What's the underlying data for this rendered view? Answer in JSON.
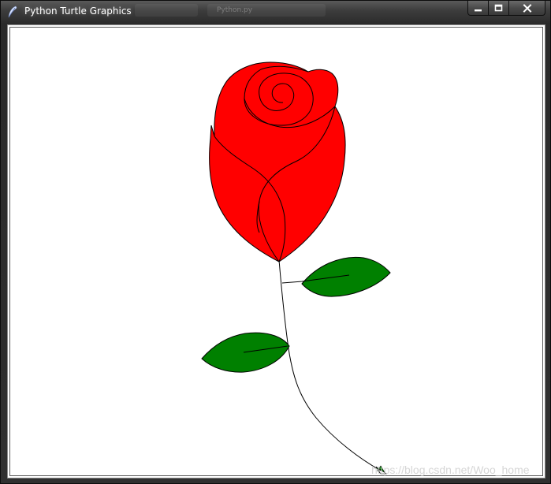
{
  "window": {
    "title": "Python Turtle Graphics",
    "background_tab": "Python.py",
    "controls": {
      "minimize": "minimize",
      "maximize": "maximize",
      "close": "close"
    }
  },
  "canvas": {
    "background": "#ffffff",
    "drawing": "rose",
    "colors": {
      "petal_fill": "#ff0000",
      "leaf_fill": "#008000",
      "outline": "#000000",
      "turtle": "#008000"
    }
  },
  "watermark": "https://blog.csdn.net/Woo_home",
  "icons": {
    "app": "feather-icon",
    "minimize": "minimize-icon",
    "maximize": "maximize-icon",
    "close": "close-icon",
    "turtle": "turtle-arrow-icon"
  }
}
